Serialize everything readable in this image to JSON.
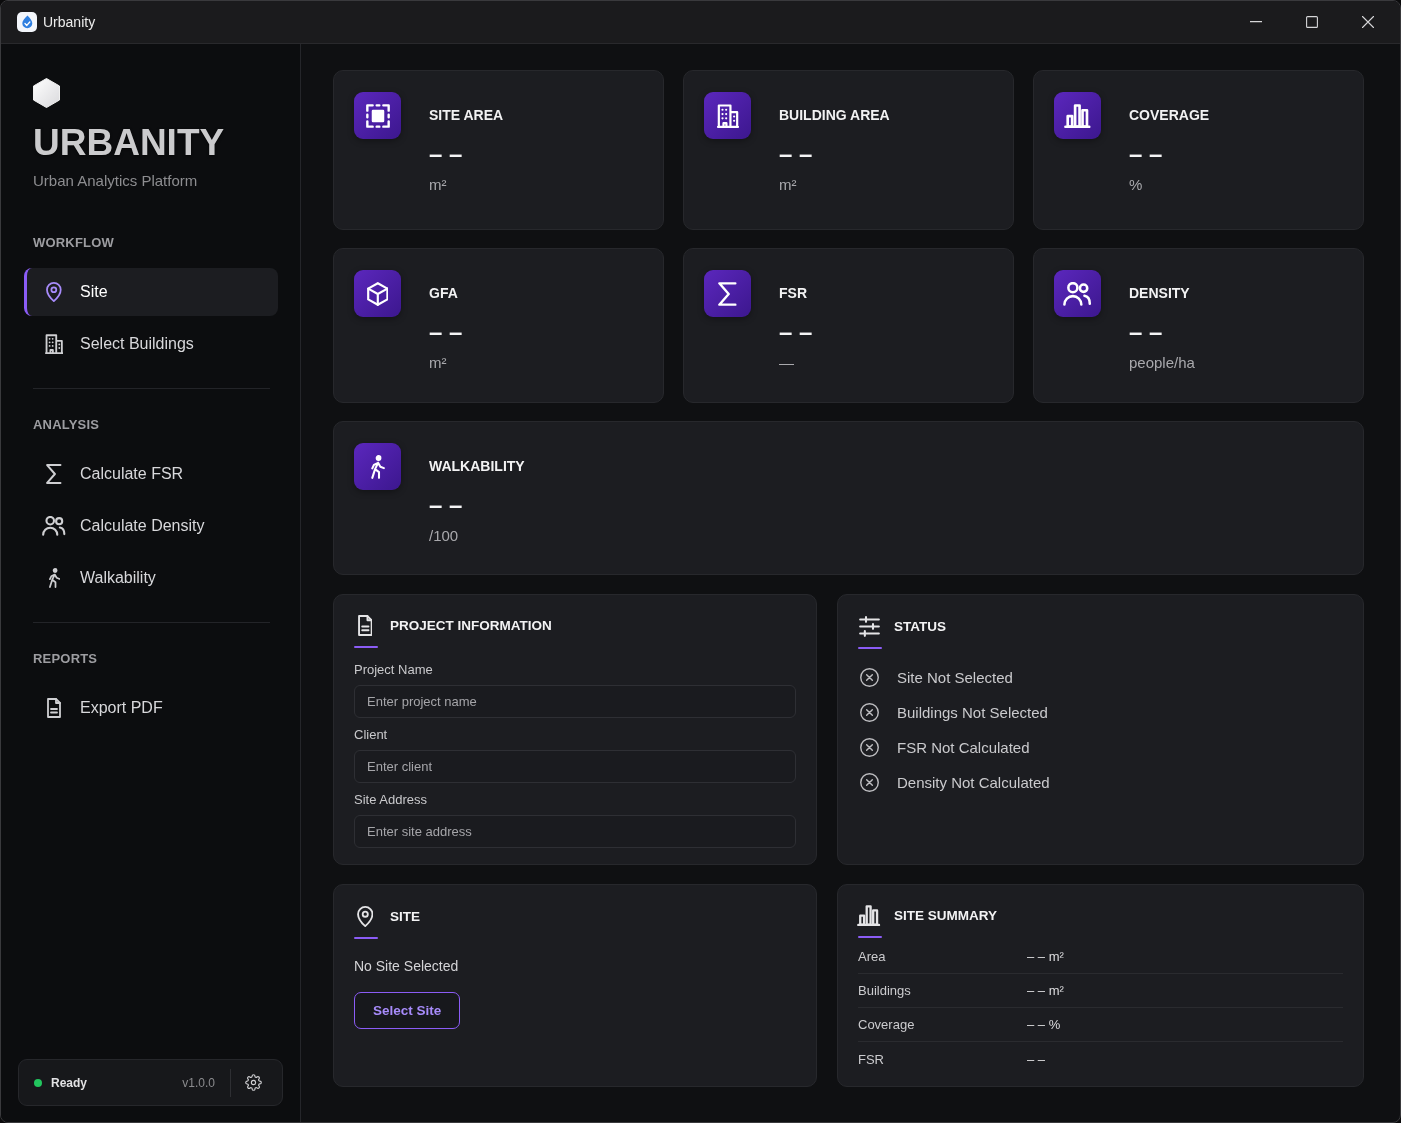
{
  "window": {
    "title": "Urbanity"
  },
  "sidebar": {
    "brand": {
      "title": "URBANITY",
      "subtitle": "Urban Analytics Platform"
    },
    "sections": [
      {
        "heading": "WORKFLOW",
        "items": [
          {
            "label": "Site",
            "selected": true
          },
          {
            "label": "Select Buildings",
            "selected": false
          }
        ]
      },
      {
        "heading": "ANALYSIS",
        "items": [
          {
            "label": "Calculate FSR",
            "selected": false
          },
          {
            "label": "Calculate Density",
            "selected": false
          },
          {
            "label": "Walkability",
            "selected": false
          }
        ]
      },
      {
        "heading": "REPORTS",
        "items": [
          {
            "label": "Export PDF",
            "selected": false
          }
        ]
      }
    ],
    "footer": {
      "status": {
        "label": "Ready",
        "color": "#22c55e"
      },
      "version": "v1.0.0"
    }
  },
  "metrics": [
    {
      "title": "SITE AREA",
      "value": "– –",
      "unit": "m²"
    },
    {
      "title": "BUILDING AREA",
      "value": "– –",
      "unit": "m²"
    },
    {
      "title": "COVERAGE",
      "value": "– –",
      "unit": "%"
    },
    {
      "title": "GFA",
      "value": "– –",
      "unit": "m²"
    },
    {
      "title": "FSR",
      "value": "– –",
      "unit": "—"
    },
    {
      "title": "DENSITY",
      "value": "– –",
      "unit": "people/ha"
    },
    {
      "title": "WALKABILITY",
      "value": "– –",
      "unit": "/100"
    }
  ],
  "project_information": {
    "title": "PROJECT INFORMATION",
    "fields": [
      {
        "label": "Project Name",
        "placeholder": "Enter project name"
      },
      {
        "label": "Client",
        "placeholder": "Enter client"
      },
      {
        "label": "Site Address",
        "placeholder": "Enter site address"
      }
    ]
  },
  "status": {
    "title": "STATUS",
    "items": [
      {
        "label": "Site Not Selected",
        "done": false
      },
      {
        "label": "Buildings Not Selected",
        "done": false
      },
      {
        "label": "FSR Not Calculated",
        "done": false
      },
      {
        "label": "Density Not Calculated",
        "done": false
      }
    ]
  },
  "site": {
    "title": "SITE",
    "message": "No Site Selected",
    "button": "Select Site"
  },
  "site_summary": {
    "title": "SITE SUMMARY",
    "rows": [
      {
        "label": "Area",
        "value": "– – m²"
      },
      {
        "label": "Buildings",
        "value": "– – m²"
      },
      {
        "label": "Coverage",
        "value": "– – %"
      },
      {
        "label": "FSR",
        "value": "– –"
      }
    ]
  }
}
